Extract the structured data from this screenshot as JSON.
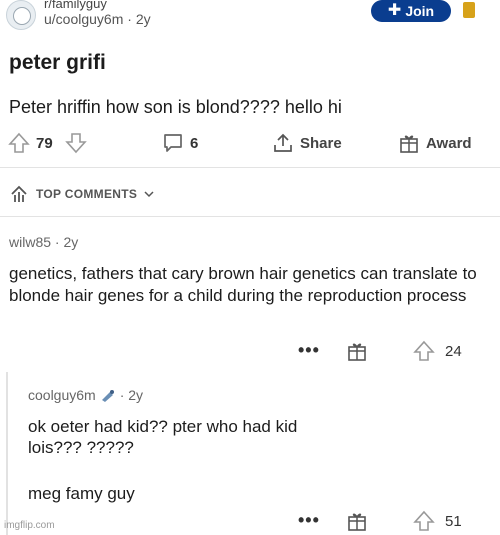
{
  "post": {
    "subreddit": "r/familyguy",
    "author": "u/coolguy6m",
    "age": "· 2y",
    "join_label": "Join",
    "title": "peter grifi",
    "body": "Peter hriffin how son is blond???? hello hi",
    "upvotes": "79",
    "comments": "6",
    "share_label": "Share",
    "award_label": "Award"
  },
  "top_comments_label": "TOP COMMENTS",
  "comments": [
    {
      "author": "wilw85",
      "age": "· 2y",
      "text": "genetics, fathers that cary brown hair genetics can translate to blonde hair genes for a child during the reproduction process",
      "dots": "•••",
      "votes": "24"
    },
    {
      "author": "coolguy6m",
      "age": "· 2y",
      "text_line1": "ok oeter had kid?? pter who had kid",
      "text_line2": "lois??? ?????",
      "text_line3": "meg famy guy",
      "dots": "•••",
      "votes": "51"
    }
  ],
  "watermark": "imgflip.com",
  "colors": {
    "join_bg": "#0a3d8f",
    "bell": "#d7a21a"
  }
}
